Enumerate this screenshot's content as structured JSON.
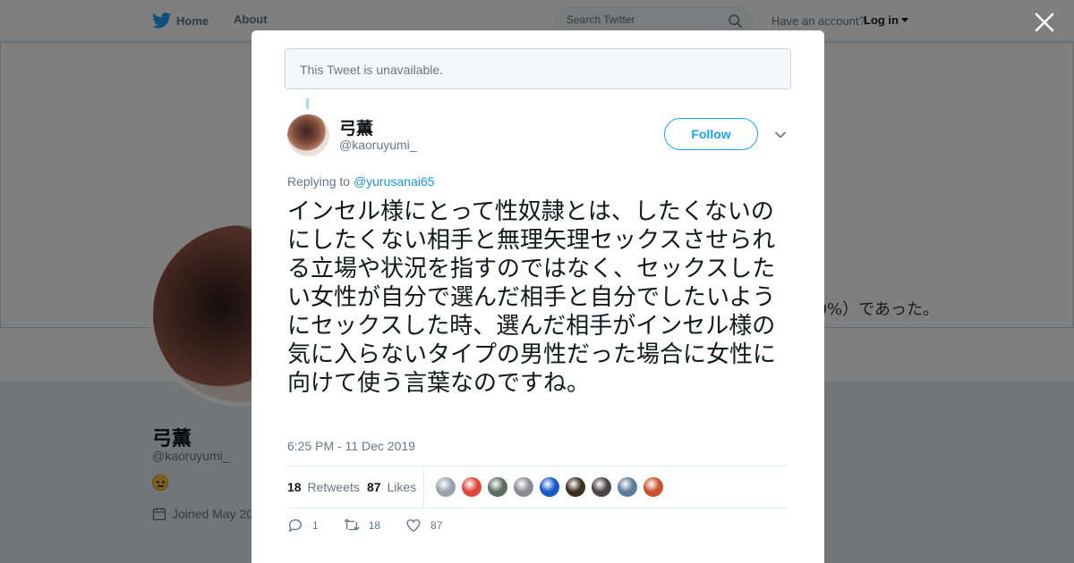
{
  "topbar": {
    "home_label": "Home",
    "about_label": "About",
    "search_placeholder": "Search Twitter",
    "account_prompt": "Have an account?",
    "login_label": "Log in"
  },
  "profile": {
    "banner_text": "0%）であった。",
    "name": "弓薫",
    "handle": "@kaoruyumi_",
    "joined": "Joined May 20"
  },
  "notice": {
    "unavailable": "This Tweet is unavailable."
  },
  "tweet": {
    "author_name": "弓薫",
    "author_handle": "@kaoruyumi_",
    "follow_label": "Follow",
    "replying_to_prefix": "Replying to",
    "replying_to_handle": "@yurusanai65",
    "text": "インセル様にとって性奴隷とは、したくないのにしたくない相手と無理矢理セックスさせられる立場や状況を指すのではなく、セックスしたい女性が自分で選んだ相手と自分でしたいようにセックスした時、選んだ相手がインセル様の気に入らないタイプの男性だった場合に女性に向けて使う言葉なのですね。",
    "timestamp": "6:25 PM - 11 Dec 2019",
    "retweets_count": "18",
    "retweets_label": "Retweets",
    "likes_count": "87",
    "likes_label": "Likes",
    "actions": {
      "reply_count": "1",
      "retweet_count": "18",
      "like_count": "87"
    }
  },
  "colors": {
    "accent": "#1da1f2",
    "link": "#1b95e0",
    "muted": "#657786",
    "likers": [
      "#9aa3ad",
      "#e0463a",
      "#5b6e63",
      "#8d8a96",
      "#1659c7",
      "#3b2e1c",
      "#4a4446",
      "#5c7a99",
      "#c9512e"
    ]
  },
  "icons": {
    "brand": "twitter-bird-icon",
    "search": "search-icon",
    "close": "close-icon",
    "more": "chevron-down-icon",
    "reply": "reply-icon",
    "retweet": "retweet-icon",
    "like": "heart-icon",
    "joined": "calendar-icon"
  }
}
